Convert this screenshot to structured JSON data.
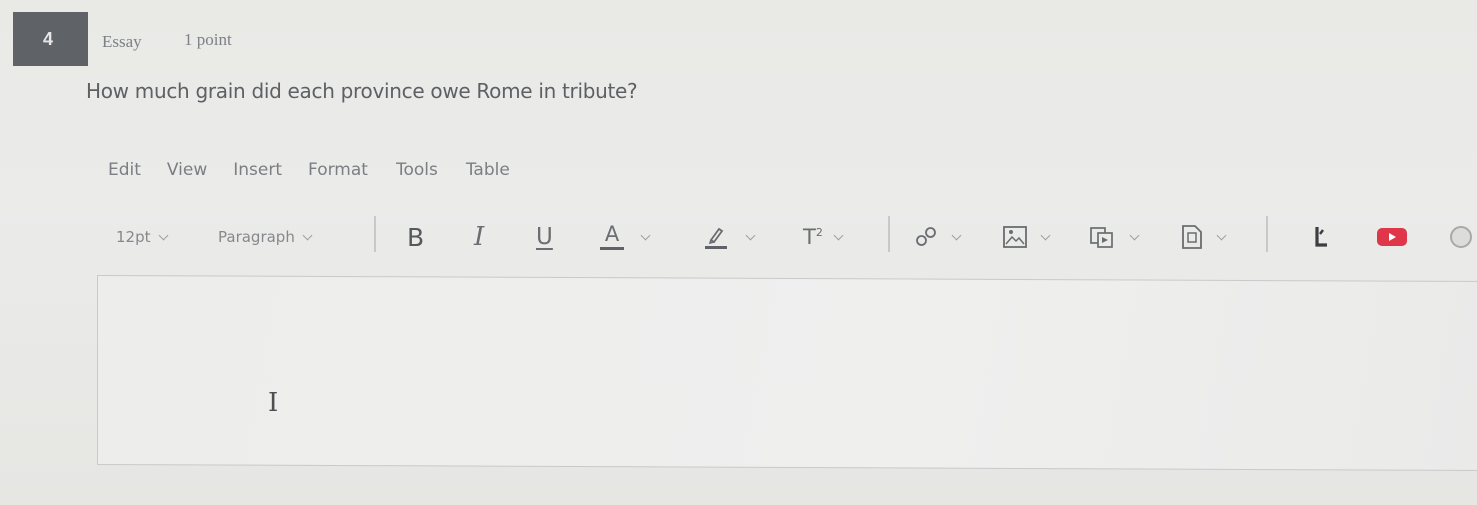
{
  "question": {
    "number": "4",
    "type": "Essay",
    "points": "1 point",
    "text": "How much grain did each province owe Rome in tribute?"
  },
  "menubar": {
    "items": [
      "Edit",
      "View",
      "Insert",
      "Format",
      "Tools",
      "Table"
    ]
  },
  "toolbar": {
    "font_size": "12pt",
    "block_format": "Paragraph",
    "bold": "B",
    "italic": "I",
    "underline": "U",
    "text_color_glyph": "A",
    "superscript_glyph": "T",
    "superscript_mark": "2",
    "icons": [
      "bold-icon",
      "italic-icon",
      "underline-icon",
      "text-color-icon",
      "highlight-icon",
      "superscript-icon",
      "link-icon",
      "image-icon",
      "media-icon",
      "document-icon",
      "plugin-icon",
      "youtube-icon",
      "more-icon"
    ]
  },
  "editor": {
    "content": ""
  },
  "colors": {
    "badge": "#5f6367",
    "youtube": "#e0364a",
    "background": "#ebebea"
  }
}
